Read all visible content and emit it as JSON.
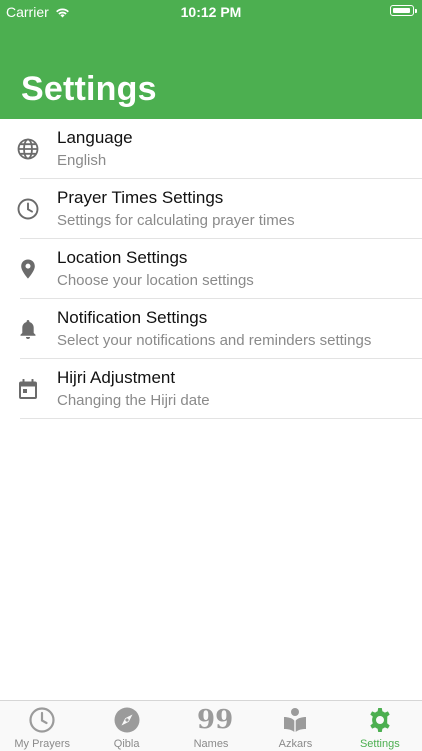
{
  "status_bar": {
    "carrier": "Carrier",
    "time": "10:12 PM"
  },
  "header": {
    "title": "Settings"
  },
  "settings": [
    {
      "icon": "globe-icon",
      "title": "Language",
      "subtitle": "English"
    },
    {
      "icon": "clock-icon",
      "title": "Prayer Times Settings",
      "subtitle": "Settings for calculating prayer times"
    },
    {
      "icon": "location-pin-icon",
      "title": "Location Settings",
      "subtitle": "Choose your location settings"
    },
    {
      "icon": "bell-icon",
      "title": "Notification Settings",
      "subtitle": "Select your notifications and reminders settings"
    },
    {
      "icon": "calendar-icon",
      "title": "Hijri Adjustment",
      "subtitle": "Changing the Hijri date"
    }
  ],
  "tabbar": {
    "active": "Settings",
    "tabs": [
      {
        "label": "My Prayers",
        "icon": "clock-icon"
      },
      {
        "label": "Qibla",
        "icon": "compass-icon"
      },
      {
        "label": "Names",
        "icon_text": "99"
      },
      {
        "label": "Azkars",
        "icon": "book-reader-icon"
      },
      {
        "label": "Settings",
        "icon": "gear-icon"
      }
    ]
  },
  "colors": {
    "accent": "#4caf50",
    "muted": "#8a8a8a",
    "icon": "#6b6b6b"
  }
}
